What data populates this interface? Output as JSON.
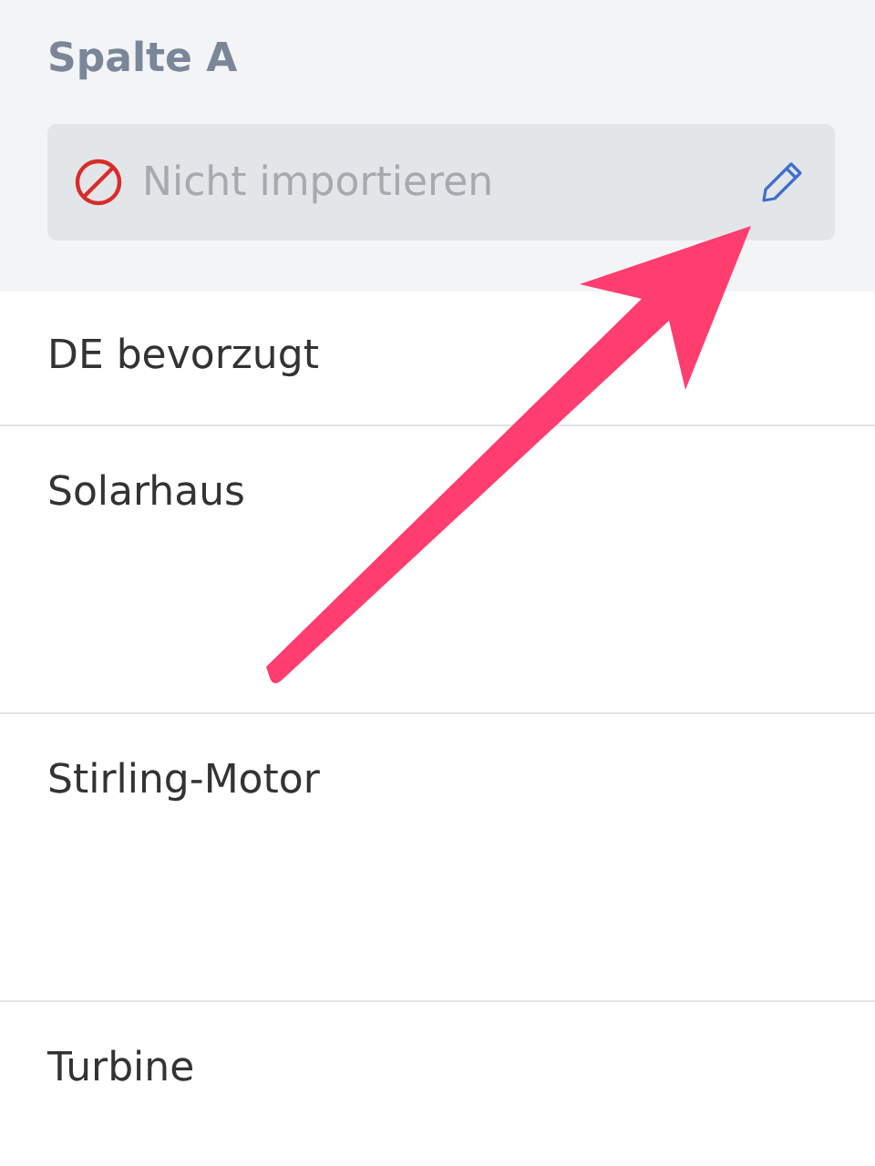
{
  "column": {
    "title": "Spalte A",
    "mapping": {
      "label": "Nicht importieren"
    }
  },
  "rows": [
    {
      "text": "DE bevorzugt"
    },
    {
      "text": "Solarhaus"
    },
    {
      "text": "Stirling-Motor"
    },
    {
      "text": "Turbine"
    }
  ]
}
